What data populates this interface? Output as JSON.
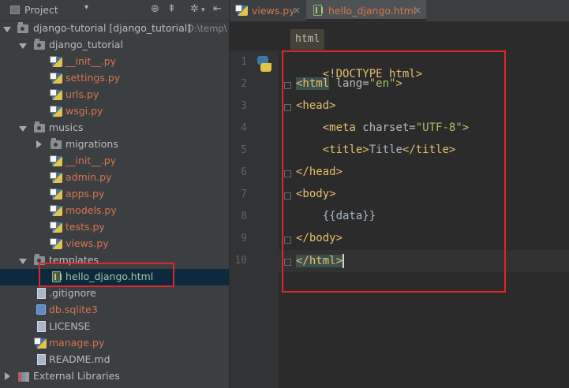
{
  "project_panel": {
    "title": "Project",
    "dropdown": "▾",
    "toolbar": [
      "sync-icon",
      "collapse-all-icon",
      "settings-icon",
      "hide-panel-icon"
    ]
  },
  "tree": {
    "root_name": "django-tutorial [django_tutorial]",
    "root_path": "D:\\temp\\",
    "items": [
      {
        "label": "django_tutorial"
      },
      {
        "label": "__init__.py"
      },
      {
        "label": "settings.py"
      },
      {
        "label": "urls.py"
      },
      {
        "label": "wsgi.py"
      },
      {
        "label": "musics"
      },
      {
        "label": "migrations"
      },
      {
        "label": "__init__.py"
      },
      {
        "label": "admin.py"
      },
      {
        "label": "apps.py"
      },
      {
        "label": "models.py"
      },
      {
        "label": "tests.py"
      },
      {
        "label": "views.py"
      },
      {
        "label": "templates"
      },
      {
        "label": "hello_django.html"
      },
      {
        "label": ".gitignore"
      },
      {
        "label": "db.sqlite3"
      },
      {
        "label": "LICENSE"
      },
      {
        "label": "manage.py"
      },
      {
        "label": "README.md"
      },
      {
        "label": "External Libraries"
      }
    ]
  },
  "editor": {
    "tabs": [
      {
        "label": "views.py"
      },
      {
        "label": "hello_django.html"
      }
    ],
    "close_glyph": "×",
    "breadcrumb": "html",
    "line_numbers": [
      "1",
      "2",
      "3",
      "4",
      "5",
      "6",
      "7",
      "8",
      "9",
      "10"
    ],
    "code": {
      "l1": "<!DOCTYPE html>",
      "l2_tag_open": "<html",
      "l2_attr": " lang=",
      "l2_val": "\"en\"",
      "l2_close": ">",
      "l3": "<head>",
      "l4_indent": "    ",
      "l4_tag": "<meta",
      "l4_attr": " charset=",
      "l4_val": "\"UTF-8\"",
      "l4_close": ">",
      "l5_indent": "    ",
      "l5_tag_open": "<title>",
      "l5_text": "Title",
      "l5_tag_close": "</title>",
      "l6": "</head>",
      "l7": "<body>",
      "l8": "    {{data}}",
      "l9": "</body>",
      "l10": "</html>"
    }
  },
  "colors": {
    "panel_bg": "#3c3f41",
    "editor_bg": "#2b2b2b",
    "tag": "#e8bf6a",
    "string": "#a5c25c",
    "filename_modified": "#d8744f",
    "highlight_box": "#e0262a"
  }
}
